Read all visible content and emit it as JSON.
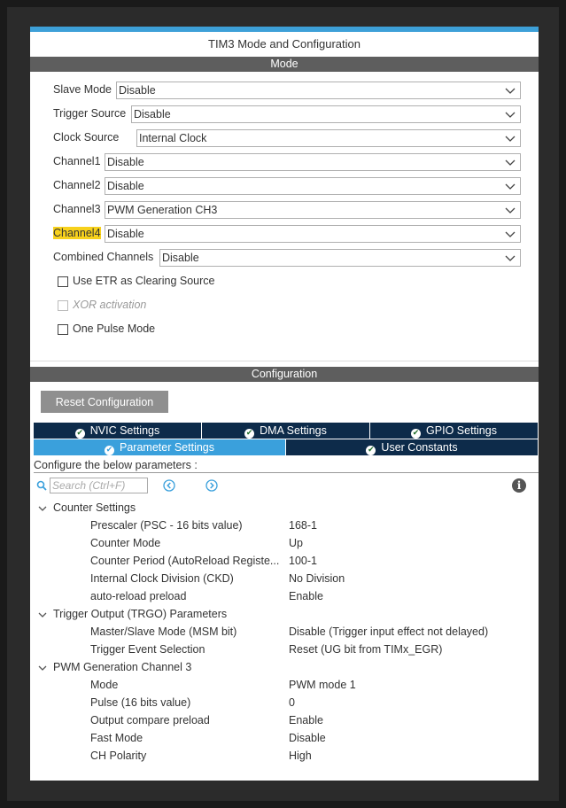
{
  "window": {
    "title": "TIM3 Mode and Configuration"
  },
  "mode": {
    "header": "Mode",
    "fields": [
      {
        "label": "Slave Mode",
        "value": "Disable"
      },
      {
        "label": "Trigger Source",
        "value": "Disable"
      },
      {
        "label": "Clock Source",
        "value": "Internal Clock"
      },
      {
        "label": "Channel1",
        "value": "Disable"
      },
      {
        "label": "Channel2",
        "value": "Disable"
      },
      {
        "label": "Channel3",
        "value": "PWM Generation CH3"
      },
      {
        "label": "Channel4",
        "value": "Disable"
      },
      {
        "label": "Combined Channels",
        "value": "Disable"
      }
    ],
    "checkboxes": [
      {
        "label": "Use ETR as Clearing Source",
        "checked": false,
        "disabled": false
      },
      {
        "label": "XOR activation",
        "checked": false,
        "disabled": true
      },
      {
        "label": "One Pulse Mode",
        "checked": false,
        "disabled": false
      }
    ],
    "highlight_color": "#f7d11c"
  },
  "configuration": {
    "header": "Configuration",
    "reset_label": "Reset Configuration",
    "tabs_row1": [
      "NVIC Settings",
      "DMA Settings",
      "GPIO Settings"
    ],
    "tabs_row2": [
      "Parameter Settings",
      "User Constants"
    ],
    "active_tab": "Parameter Settings",
    "description": "Configure the below parameters :",
    "search_placeholder": "Search (Ctrl+F)",
    "info_symbol": "i",
    "groups": [
      {
        "name": "Counter Settings",
        "params": [
          {
            "name": "Prescaler (PSC - 16 bits value)",
            "value": "168-1"
          },
          {
            "name": "Counter Mode",
            "value": "Up"
          },
          {
            "name": "Counter Period (AutoReload Registe...",
            "value": "100-1"
          },
          {
            "name": "Internal Clock Division (CKD)",
            "value": "No Division"
          },
          {
            "name": "auto-reload preload",
            "value": "Enable"
          }
        ]
      },
      {
        "name": "Trigger Output (TRGO) Parameters",
        "params": [
          {
            "name": "Master/Slave Mode (MSM bit)",
            "value": "Disable (Trigger input effect not delayed)"
          },
          {
            "name": "Trigger Event Selection",
            "value": "Reset (UG bit from TIMx_EGR)"
          }
        ]
      },
      {
        "name": "PWM Generation Channel 3",
        "params": [
          {
            "name": "Mode",
            "value": "PWM mode 1"
          },
          {
            "name": "Pulse (16 bits value)",
            "value": "0"
          },
          {
            "name": "Output compare preload",
            "value": "Enable"
          },
          {
            "name": "Fast Mode",
            "value": "Disable"
          },
          {
            "name": "CH Polarity",
            "value": "High"
          }
        ]
      }
    ]
  },
  "colors": {
    "accent": "#3aa0dc",
    "tab_dark": "#0d2b4a",
    "header_gray": "#5e5e5e"
  }
}
